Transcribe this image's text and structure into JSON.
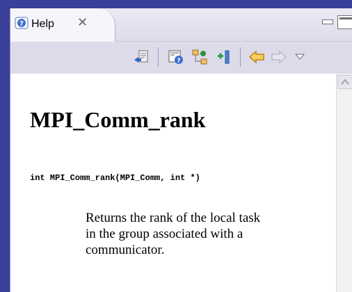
{
  "tab": {
    "label": "Help",
    "close_glyph": "✕",
    "icon": "help-icon"
  },
  "window_controls": [
    "minimize-icon",
    "maximize-icon"
  ],
  "toolbar": {
    "icons": [
      "show-in-contents-icon",
      "show-all-topics-icon",
      "link-with-editor-icon",
      "add-bookmark-icon",
      "back-icon",
      "forward-icon",
      "view-menu-icon"
    ]
  },
  "document": {
    "title": "MPI_Comm_rank",
    "signature": "int MPI_Comm_rank(MPI_Comm, int *)",
    "description": "Returns the rank of the local task in the group associated with a communicator."
  },
  "colors": {
    "frame": "#3a3f9a",
    "toolbar": "#dddaea",
    "tab": "#f6f5fa",
    "arrow": "#f0a030"
  }
}
